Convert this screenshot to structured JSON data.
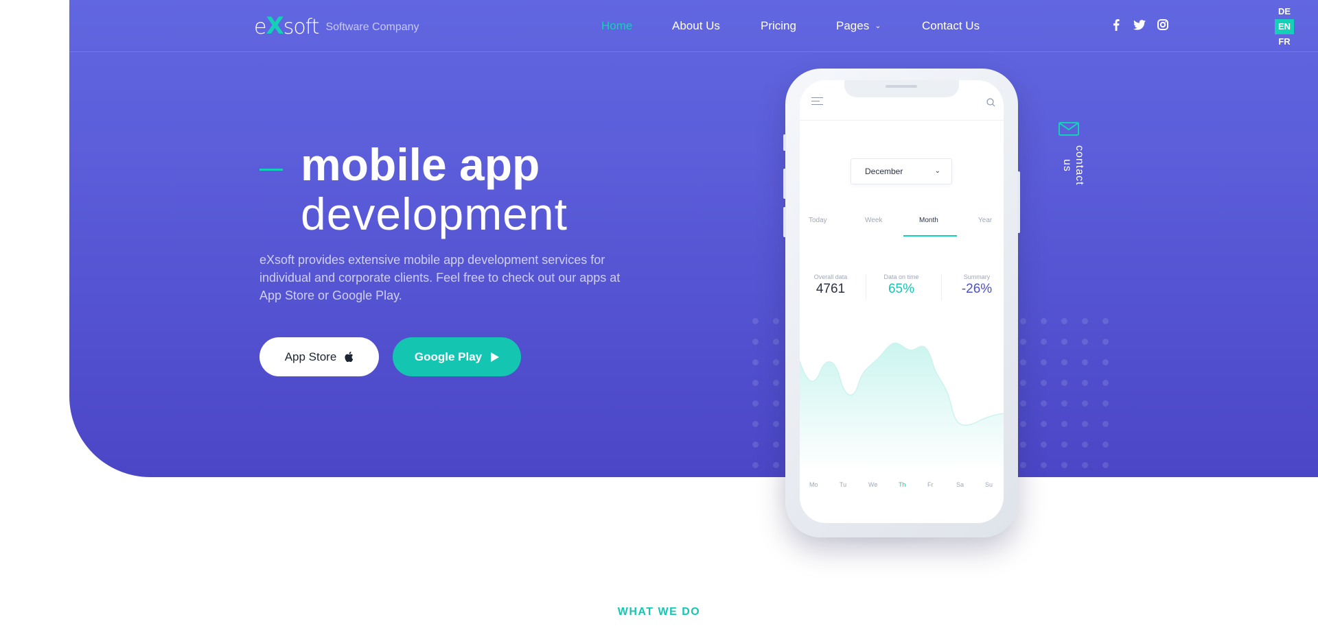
{
  "brand": {
    "logo_prefix": "e",
    "logo_x": "X",
    "logo_suffix": "soft",
    "tagline": "Software Company"
  },
  "nav": {
    "items": [
      "Home",
      "About Us",
      "Pricing",
      "Pages",
      "Contact Us"
    ],
    "active": "Home"
  },
  "social": [
    "facebook-icon",
    "twitter-icon",
    "instagram-icon"
  ],
  "languages": {
    "items": [
      "DE",
      "EN",
      "FR"
    ],
    "active": "EN"
  },
  "hero": {
    "title_line1": "mobile app",
    "title_line2": "development",
    "description": "eXsoft provides extensive mobile app development services for individual and corporate clients. Feel free to check out our apps at App Store or Google Play.",
    "btn_app_store": "App Store",
    "btn_google_play": "Google Play"
  },
  "contact_side": {
    "label": "contact us"
  },
  "phone": {
    "month": "December",
    "tabs": [
      "Today",
      "Week",
      "Month",
      "Year"
    ],
    "active_tab": "Month",
    "stats": [
      {
        "label": "Overall data",
        "value": "4761"
      },
      {
        "label": "Data on time",
        "value": "65%"
      },
      {
        "label": "Summary",
        "value": "-26%"
      }
    ],
    "days": [
      "Mo",
      "Tu",
      "We",
      "Th",
      "Fr",
      "Sa",
      "Su"
    ],
    "active_day": "Th"
  },
  "section": {
    "what_we_do": "WHAT WE DO"
  },
  "colors": {
    "accent": "#14d0b8",
    "hero_top": "#6167e0",
    "hero_bottom": "#4b46c6",
    "stat_dark": "#2a3142",
    "stat_teal": "#14c6b2",
    "stat_indigo": "#4a4fd0"
  }
}
